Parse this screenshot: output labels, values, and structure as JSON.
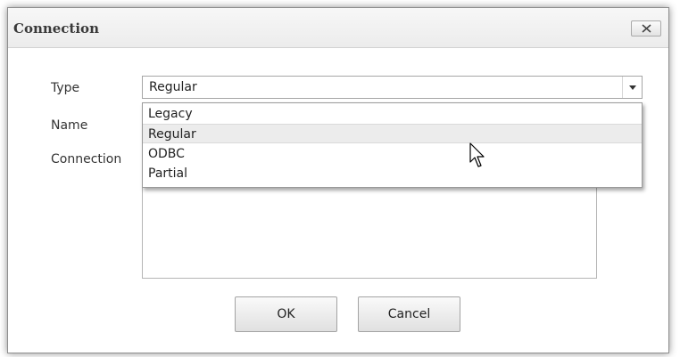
{
  "dialog": {
    "title": "Connection",
    "close_icon": "close-icon"
  },
  "form": {
    "type_label": "Type",
    "name_label": "Name",
    "connection_label": "Connection",
    "type_value": "Regular",
    "type_dropdown_icon": "chevron-down-icon"
  },
  "dropdown": {
    "options": [
      "Legacy",
      "Regular",
      "ODBC",
      "Partial"
    ],
    "highlighted": "Regular"
  },
  "buttons": {
    "ok": "OK",
    "cancel": "Cancel"
  },
  "colors": {
    "titlebar": "#ececec",
    "highlight": "#ececec",
    "border": "#a5a5a5"
  }
}
